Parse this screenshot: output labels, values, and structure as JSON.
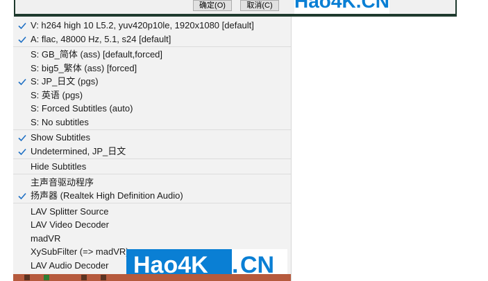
{
  "dialog": {
    "ok_button": "确定(O)",
    "cancel_button": "取消(C)"
  },
  "watermark_top": {
    "hao": "Hao4K",
    "dot": ".",
    "cn": "CN"
  },
  "menu": {
    "groups": [
      [
        {
          "label": "V: h264 high 10 L5.2, yuv420p10le, 1920x1080 [default]",
          "checked": true
        },
        {
          "label": "A: flac, 48000 Hz, 5.1, s24 [default]",
          "checked": true
        }
      ],
      [
        {
          "label": "S: GB_简体 (ass) [default,forced]",
          "checked": false
        },
        {
          "label": "S: big5_繁体 (ass) [forced]",
          "checked": false
        },
        {
          "label": "S: JP_日文 (pgs)",
          "checked": true
        },
        {
          "label": "S: 英语 (pgs)",
          "checked": false
        },
        {
          "label": "S: Forced Subtitles (auto)",
          "checked": false
        },
        {
          "label": "S: No subtitles",
          "checked": false
        }
      ],
      [
        {
          "label": "Show Subtitles",
          "checked": true
        },
        {
          "label": "Undetermined, JP_日文",
          "checked": true
        }
      ],
      [
        {
          "label": "Hide Subtitles",
          "checked": false
        }
      ],
      [
        {
          "label": "主声音驱动程序",
          "checked": false
        },
        {
          "label": "扬声器 (Realtek High Definition Audio)",
          "checked": true
        }
      ],
      [
        {
          "label": "LAV Splitter Source",
          "checked": false
        },
        {
          "label": "LAV Video Decoder",
          "checked": false
        },
        {
          "label": "madVR",
          "checked": false
        },
        {
          "label": "XySubFilter (=> madVR)",
          "checked": false
        },
        {
          "label": "LAV Audio Decoder",
          "checked": false
        }
      ]
    ]
  },
  "watermark_bottom": {
    "hao": "Hao4K",
    "dot": ".",
    "cn": "CN"
  },
  "colors": {
    "check": "#1d6fc4",
    "menu_bg": "#f2f2f2",
    "watermark_blue": "#0a7fd4"
  }
}
